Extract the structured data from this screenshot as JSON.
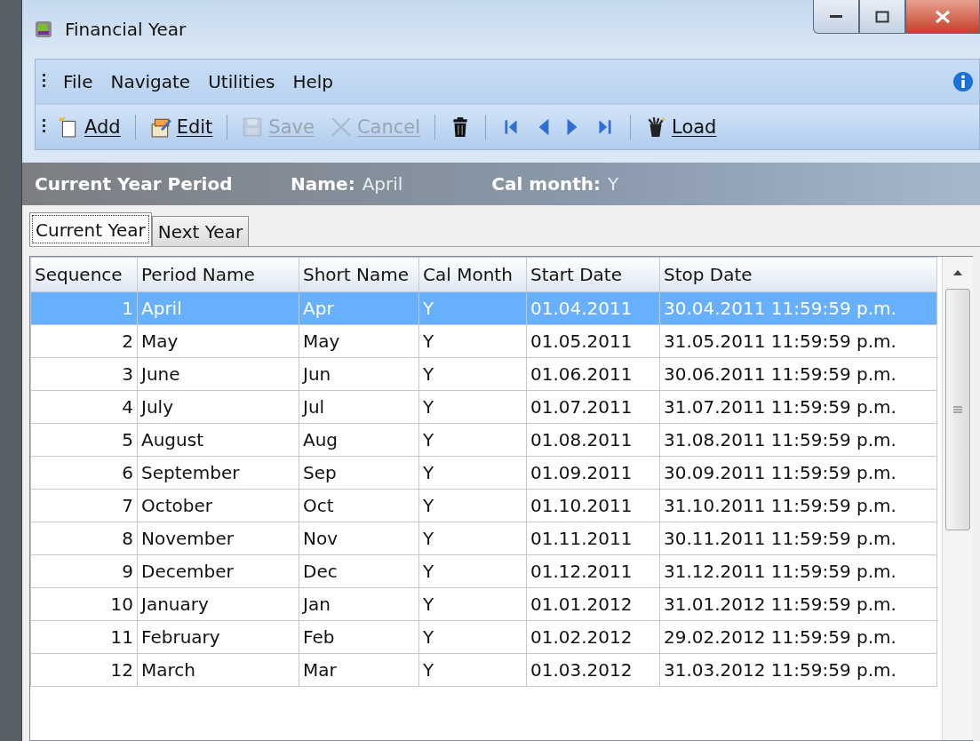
{
  "window": {
    "title": "Financial Year"
  },
  "menu": [
    "File",
    "Navigate",
    "Utilities",
    "Help"
  ],
  "toolbar": [
    {
      "kind": "button",
      "label": "Add",
      "disabled": false
    },
    {
      "kind": "button",
      "label": "Edit",
      "disabled": false
    },
    {
      "kind": "button",
      "label": "Save",
      "disabled": true
    },
    {
      "kind": "button",
      "label": "Cancel",
      "disabled": true
    },
    {
      "kind": "icon",
      "disabled": false
    },
    {
      "kind": "icon",
      "disabled": false
    },
    {
      "kind": "icon",
      "disabled": false
    },
    {
      "kind": "icon",
      "disabled": false
    },
    {
      "kind": "icon",
      "disabled": false
    },
    {
      "kind": "button",
      "label": "Load",
      "disabled": false
    }
  ],
  "header": {
    "title": "Current Year Period",
    "fields": [
      {
        "label": "Name:",
        "value": "April"
      },
      {
        "label": "Cal month:",
        "value": "Y"
      }
    ]
  },
  "tabs": [
    {
      "label": "Current Year",
      "selected": true
    },
    {
      "label": "Next Year",
      "selected": false
    }
  ],
  "table": {
    "columns": [
      "Sequence",
      "Period Name",
      "Short Name",
      "Cal Month",
      "Start Date",
      "Stop Date"
    ],
    "rows": [
      {
        "cells": [
          "1",
          "April",
          "Apr",
          "Y",
          "01.04.2011",
          "30.04.2011 11:59:59 p.m."
        ],
        "selected": true
      },
      {
        "cells": [
          "2",
          "May",
          "May",
          "Y",
          "01.05.2011",
          "31.05.2011 11:59:59 p.m."
        ],
        "selected": false
      },
      {
        "cells": [
          "3",
          "June",
          "Jun",
          "Y",
          "01.06.2011",
          "30.06.2011 11:59:59 p.m."
        ],
        "selected": false
      },
      {
        "cells": [
          "4",
          "July",
          "Jul",
          "Y",
          "01.07.2011",
          "31.07.2011 11:59:59 p.m."
        ],
        "selected": false
      },
      {
        "cells": [
          "5",
          "August",
          "Aug",
          "Y",
          "01.08.2011",
          "31.08.2011 11:59:59 p.m."
        ],
        "selected": false
      },
      {
        "cells": [
          "6",
          "September",
          "Sep",
          "Y",
          "01.09.2011",
          "30.09.2011 11:59:59 p.m."
        ],
        "selected": false
      },
      {
        "cells": [
          "7",
          "October",
          "Oct",
          "Y",
          "01.10.2011",
          "31.10.2011 11:59:59 p.m."
        ],
        "selected": false
      },
      {
        "cells": [
          "8",
          "November",
          "Nov",
          "Y",
          "01.11.2011",
          "30.11.2011 11:59:59 p.m."
        ],
        "selected": false
      },
      {
        "cells": [
          "9",
          "December",
          "Dec",
          "Y",
          "01.12.2011",
          "31.12.2011 11:59:59 p.m."
        ],
        "selected": false
      },
      {
        "cells": [
          "10",
          "January",
          "Jan",
          "Y",
          "01.01.2012",
          "31.01.2012 11:59:59 p.m."
        ],
        "selected": false
      },
      {
        "cells": [
          "11",
          "February",
          "Feb",
          "Y",
          "01.02.2012",
          "29.02.2012 11:59:59 p.m."
        ],
        "selected": false
      },
      {
        "cells": [
          "12",
          "March",
          "Mar",
          "Y",
          "01.03.2012",
          "31.03.2012 11:59:59 p.m."
        ],
        "selected": false
      }
    ]
  }
}
